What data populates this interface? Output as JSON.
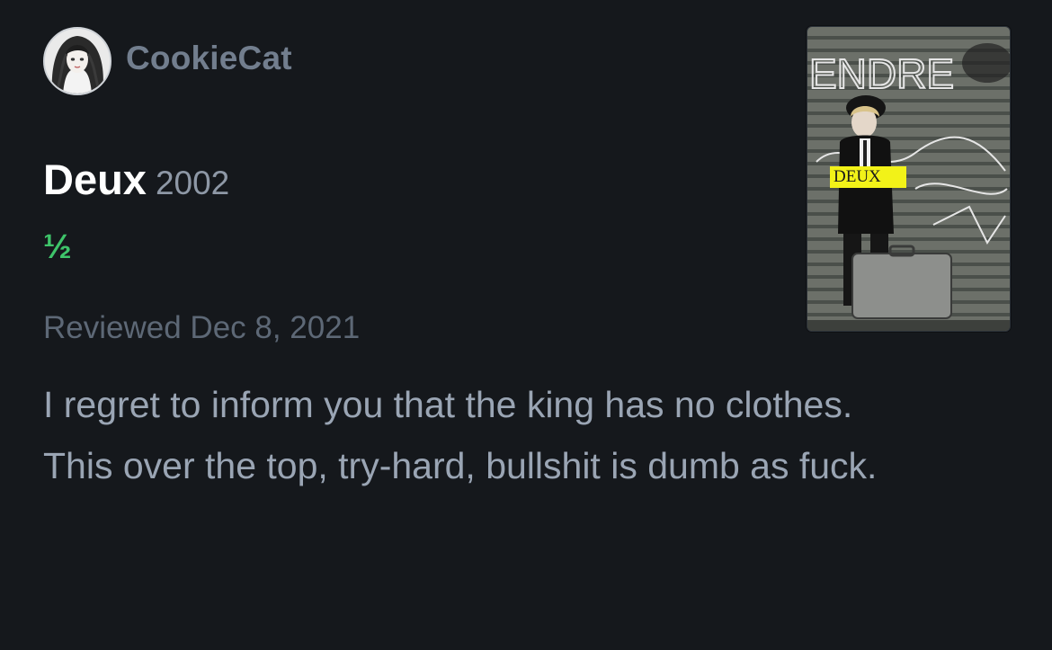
{
  "review": {
    "username": "CookieCat",
    "film_title": "Deux",
    "film_year": "2002",
    "rating": "½",
    "reviewed_label": "Reviewed Dec 8, 2021",
    "body": [
      "I regret to inform you that the king has no clothes.",
      "This over the top, try-hard, bullshit is dumb as fuck."
    ]
  },
  "poster": {
    "title_text": "DEUX",
    "graffiti_text": "ENDRE"
  },
  "colors": {
    "background": "#15181c",
    "rating_green": "#3ec46a",
    "title_white": "#ffffff",
    "muted_text": "#8e98a6"
  },
  "icons": {
    "avatar": "user-avatar-illustration"
  }
}
